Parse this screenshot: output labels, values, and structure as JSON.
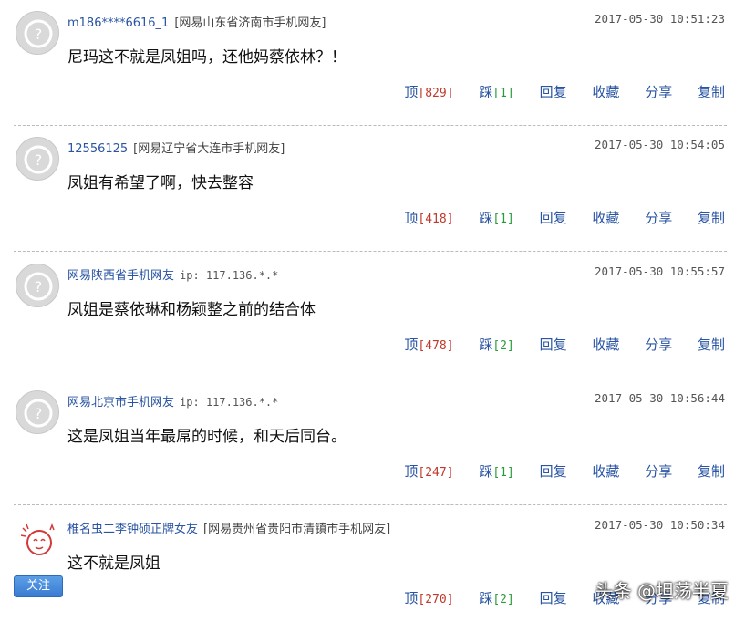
{
  "comments": [
    {
      "user": "m186****6616_1",
      "location": "[网易山东省济南市手机网友]",
      "ip": "",
      "time": "2017-05-30 10:51:23",
      "text": "尼玛这不就是凤姐吗，还他妈蔡依林？！",
      "up_count": "[829]",
      "down_count": "[1]"
    },
    {
      "user": "12556125",
      "location": "[网易辽宁省大连市手机网友]",
      "ip": "",
      "time": "2017-05-30 10:54:05",
      "text": "凤姐有希望了啊，快去整容",
      "up_count": "[418]",
      "down_count": "[1]"
    },
    {
      "user": "网易陕西省手机网友",
      "location": "",
      "ip": "ip: 117.136.*.*",
      "time": "2017-05-30 10:55:57",
      "text": "凤姐是蔡依琳和杨颖整之前的结合体",
      "up_count": "[478]",
      "down_count": "[2]"
    },
    {
      "user": "网易北京市手机网友",
      "location": "",
      "ip": "ip: 117.136.*.*",
      "time": "2017-05-30 10:56:44",
      "text": "这是凤姐当年最屌的时候，和天后同台。",
      "up_count": "[247]",
      "down_count": "[1]"
    },
    {
      "user": "椎名虫二李钟硕正牌女友",
      "location": "[网易贵州省贵阳市清镇市手机网友]",
      "ip": "",
      "time": "2017-05-30 10:50:34",
      "text": "这不就是凤姐",
      "up_count": "[270]",
      "down_count": "[2]"
    }
  ],
  "actions": {
    "up": "顶",
    "down": "踩",
    "reply": "回复",
    "favorite": "收藏",
    "share": "分享",
    "copy": "复制"
  },
  "follow_label": "关注",
  "watermark": "头条 @坦荡半夏",
  "icons": {
    "default_avatar": "default-avatar-icon",
    "custom_avatar": "cartoon-avatar-icon"
  }
}
